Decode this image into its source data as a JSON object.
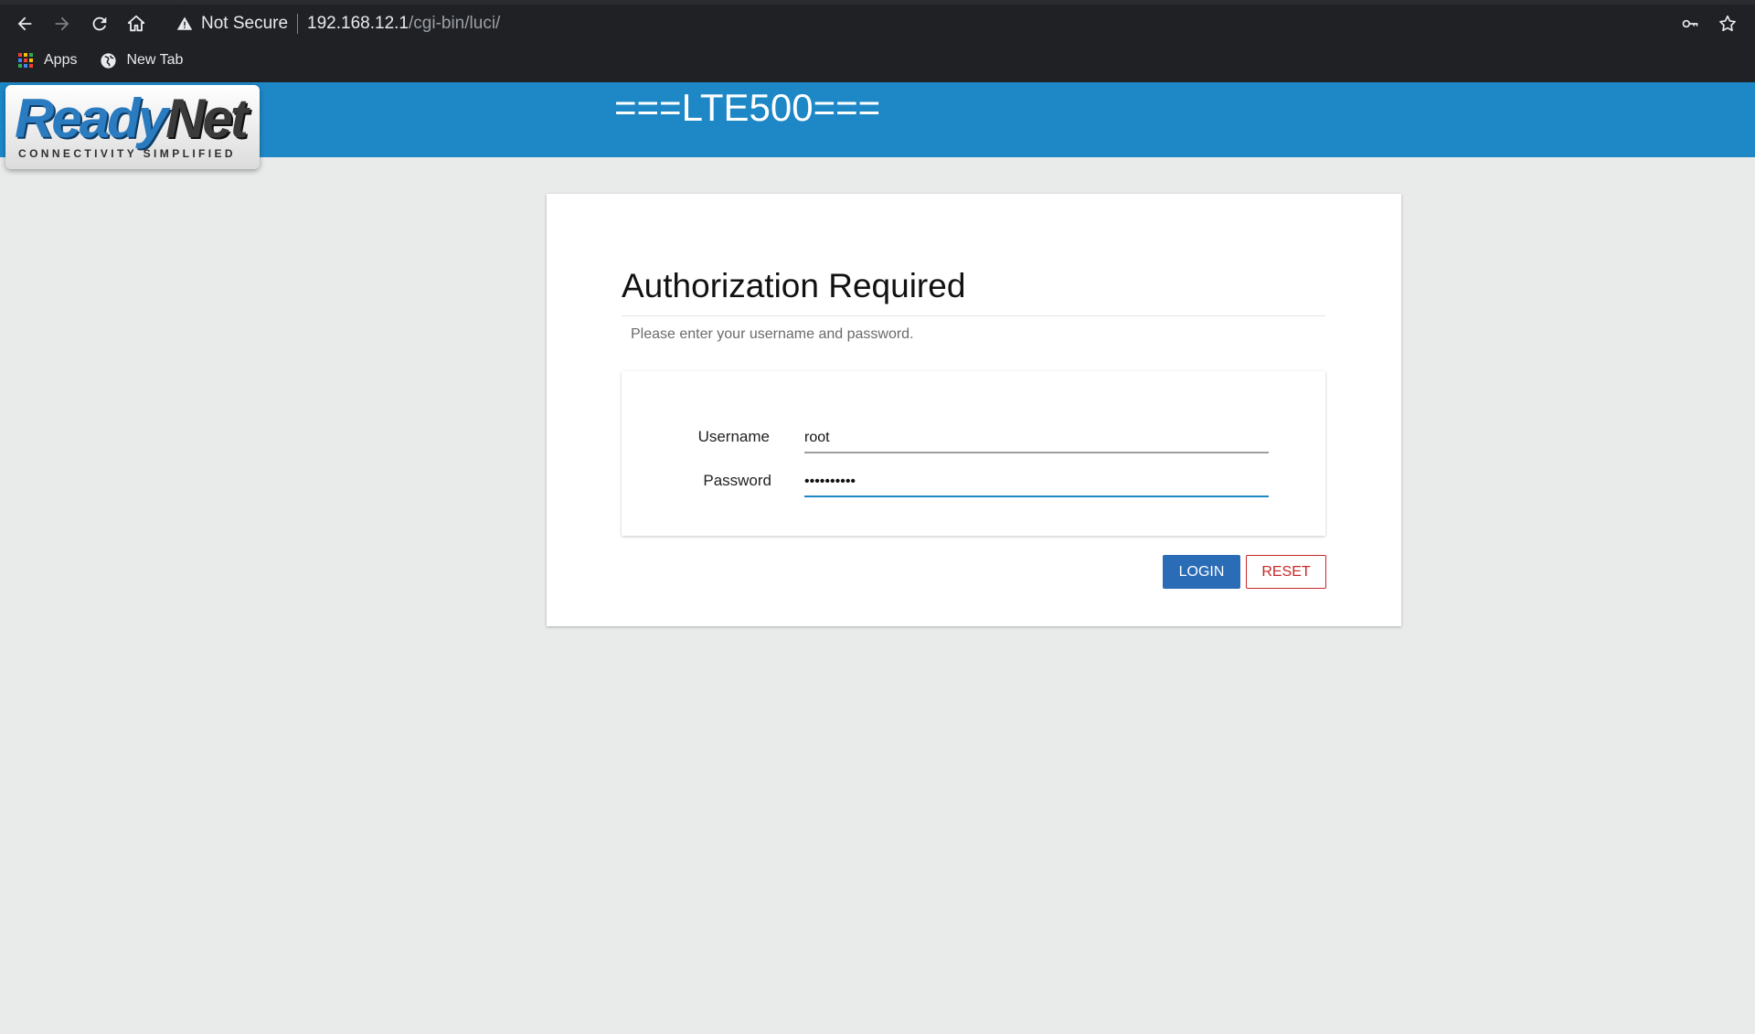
{
  "browser": {
    "security_label": "Not Secure",
    "url_host": "192.168.12.1",
    "url_path": "/cgi-bin/luci/",
    "bookmarks": [
      {
        "label": "Apps",
        "icon": "apps-grid-icon"
      },
      {
        "label": "New Tab",
        "icon": "globe-icon"
      }
    ]
  },
  "header": {
    "title": "===LTE500===",
    "logo_text_main": "ReadyNet",
    "logo_text_part1": "Ready",
    "logo_text_part2": "Net",
    "logo_tagline": "CONNECTIVITY SIMPLIFIED",
    "color": "#1e88c7"
  },
  "login": {
    "title": "Authorization Required",
    "description": "Please enter your username and password.",
    "username_label": "Username",
    "username_value": "root",
    "password_label": "Password",
    "password_value": "••••••••••",
    "login_button": "LOGIN",
    "reset_button": "RESET",
    "login_color": "#2b6cb6",
    "reset_color": "#c62828"
  }
}
